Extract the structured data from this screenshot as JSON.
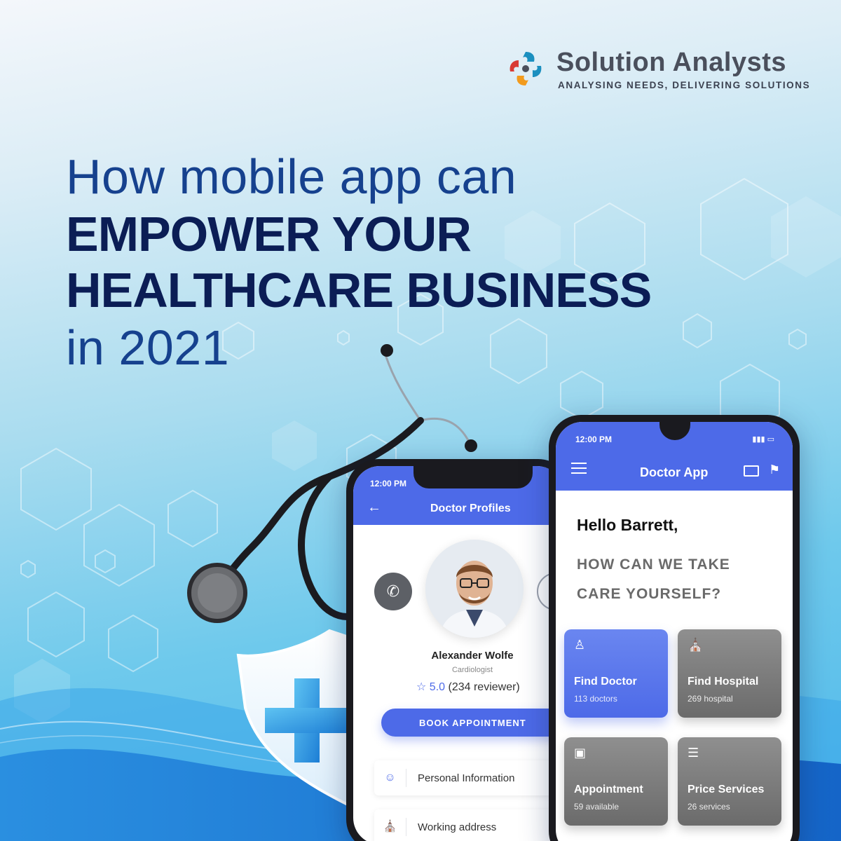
{
  "brand": {
    "name": "Solution Analysts",
    "tagline": "ANALYSING NEEDS, DELIVERING SOLUTIONS",
    "colors": [
      "#1b8fbf",
      "#d83a34",
      "#f29b1d",
      "#4a4f5c"
    ]
  },
  "headline": {
    "line1": "How mobile app can",
    "line2": "EMPOWER YOUR",
    "line3": "HEALTHCARE BUSINESS",
    "line4": "in 2021"
  },
  "doctor_profile_screen": {
    "time": "12:00 PM",
    "back_icon": "arrow-left-icon",
    "title": "Doctor Profiles",
    "doctor_name": "Alexander Wolfe",
    "specialty": "Cardiologist",
    "rating_icon": "star-icon",
    "rating": "5.0",
    "reviews": "(234 reviewer)",
    "book_button": "BOOK APPOINTMENT",
    "info_rows": [
      {
        "icon": "person-icon",
        "label": "Personal Information"
      },
      {
        "icon": "building-icon",
        "label": "Working address"
      }
    ]
  },
  "doctor_app_screen": {
    "time": "12:00 PM",
    "title": "Doctor App",
    "greeting": "Hello Barrett,",
    "question_line1": "HOW CAN WE TAKE",
    "question_line2": "CARE YOURSELF?",
    "cards": [
      {
        "icon": "doctor-icon",
        "title": "Find Doctor",
        "sub": "113 doctors",
        "active": true
      },
      {
        "icon": "hospital-icon",
        "title": "Find Hospital",
        "sub": "269 hospital",
        "active": false
      },
      {
        "icon": "calendar-icon",
        "title": "Appointment",
        "sub": "59 available",
        "active": false
      },
      {
        "icon": "clipboard-icon",
        "title": "Price Services",
        "sub": "26 services",
        "active": false
      }
    ]
  },
  "accent_color": "#4d6ae8"
}
